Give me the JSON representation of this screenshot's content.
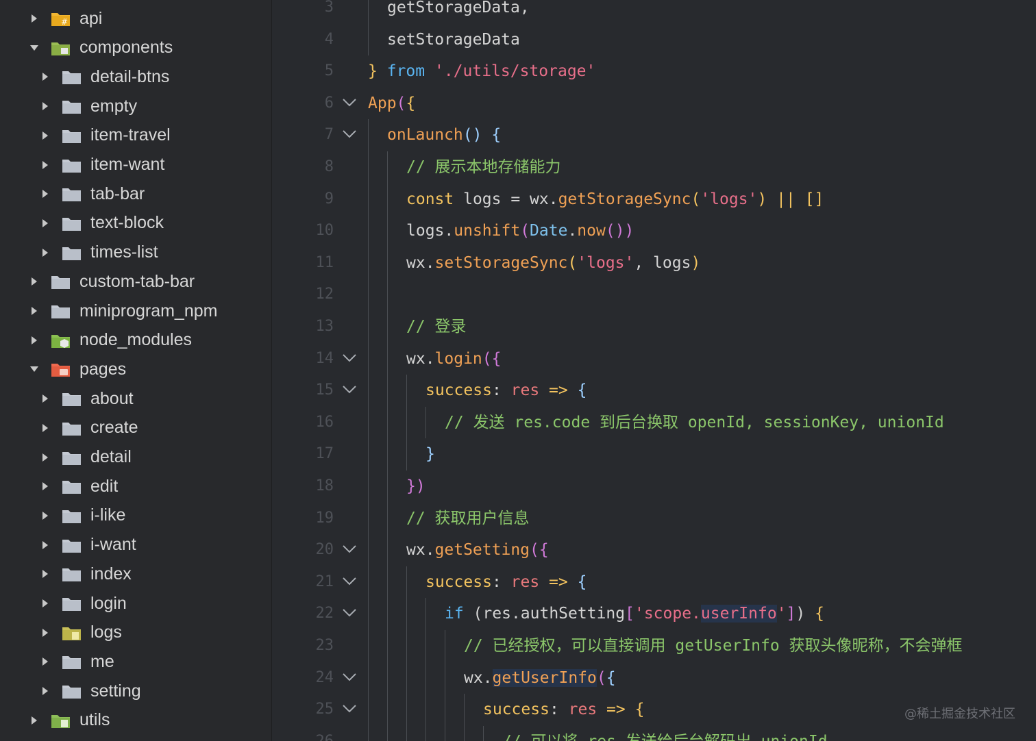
{
  "sidebar": {
    "items": [
      {
        "label": "api",
        "depth": 0,
        "expanded": false,
        "icon": "api-folder-icon"
      },
      {
        "label": "components",
        "depth": 0,
        "expanded": true,
        "icon": "components-folder-icon"
      },
      {
        "label": "detail-btns",
        "depth": 1,
        "expanded": false,
        "icon": "folder-icon"
      },
      {
        "label": "empty",
        "depth": 1,
        "expanded": false,
        "icon": "folder-icon"
      },
      {
        "label": "item-travel",
        "depth": 1,
        "expanded": false,
        "icon": "folder-icon"
      },
      {
        "label": "item-want",
        "depth": 1,
        "expanded": false,
        "icon": "folder-icon"
      },
      {
        "label": "tab-bar",
        "depth": 1,
        "expanded": false,
        "icon": "folder-icon"
      },
      {
        "label": "text-block",
        "depth": 1,
        "expanded": false,
        "icon": "folder-icon"
      },
      {
        "label": "times-list",
        "depth": 1,
        "expanded": false,
        "icon": "folder-icon"
      },
      {
        "label": "custom-tab-bar",
        "depth": 0,
        "expanded": false,
        "icon": "folder-icon"
      },
      {
        "label": "miniprogram_npm",
        "depth": 0,
        "expanded": false,
        "icon": "folder-icon"
      },
      {
        "label": "node_modules",
        "depth": 0,
        "expanded": false,
        "icon": "node-modules-folder-icon"
      },
      {
        "label": "pages",
        "depth": 0,
        "expanded": true,
        "icon": "pages-folder-icon"
      },
      {
        "label": "about",
        "depth": 1,
        "expanded": false,
        "icon": "folder-icon"
      },
      {
        "label": "create",
        "depth": 1,
        "expanded": false,
        "icon": "folder-icon"
      },
      {
        "label": "detail",
        "depth": 1,
        "expanded": false,
        "icon": "folder-icon"
      },
      {
        "label": "edit",
        "depth": 1,
        "expanded": false,
        "icon": "folder-icon"
      },
      {
        "label": "i-like",
        "depth": 1,
        "expanded": false,
        "icon": "folder-icon"
      },
      {
        "label": "i-want",
        "depth": 1,
        "expanded": false,
        "icon": "folder-icon"
      },
      {
        "label": "index",
        "depth": 1,
        "expanded": false,
        "icon": "folder-icon"
      },
      {
        "label": "login",
        "depth": 1,
        "expanded": false,
        "icon": "folder-icon"
      },
      {
        "label": "logs",
        "depth": 1,
        "expanded": false,
        "icon": "logs-folder-icon"
      },
      {
        "label": "me",
        "depth": 1,
        "expanded": false,
        "icon": "folder-icon"
      },
      {
        "label": "setting",
        "depth": 1,
        "expanded": false,
        "icon": "folder-icon"
      },
      {
        "label": "utils",
        "depth": 0,
        "expanded": false,
        "icon": "utils-folder-icon"
      }
    ]
  },
  "editor": {
    "lines": [
      {
        "num": "3",
        "indent": 1,
        "fold": false,
        "tokens": [
          [
            "getStorageData,",
            "base"
          ]
        ]
      },
      {
        "num": "4",
        "indent": 1,
        "fold": false,
        "tokens": [
          [
            "setStorageData",
            "base"
          ]
        ]
      },
      {
        "num": "5",
        "indent": 0,
        "fold": false,
        "tokens": [
          [
            "}",
            "kw"
          ],
          [
            " ",
            "base"
          ],
          [
            "from",
            "from"
          ],
          [
            " ",
            "base"
          ],
          [
            "'./utils/storage'",
            "str"
          ]
        ]
      },
      {
        "num": "6",
        "indent": 0,
        "fold": true,
        "tokens": [
          [
            "App",
            "fn"
          ],
          [
            "(",
            "br2"
          ],
          [
            "{",
            "kw"
          ]
        ]
      },
      {
        "num": "7",
        "indent": 1,
        "fold": true,
        "tokens": [
          [
            "onLaunch",
            "fn"
          ],
          [
            "() ",
            "br"
          ],
          [
            "{",
            "br"
          ]
        ]
      },
      {
        "num": "8",
        "indent": 2,
        "fold": false,
        "tokens": [
          [
            "// 展示本地存储能力",
            "cm"
          ]
        ]
      },
      {
        "num": "9",
        "indent": 2,
        "fold": false,
        "tokens": [
          [
            "const",
            "kw"
          ],
          [
            " logs = wx.",
            "base"
          ],
          [
            "getStorageSync",
            "fn"
          ],
          [
            "(",
            "kw"
          ],
          [
            "'logs'",
            "str"
          ],
          [
            ")",
            "kw"
          ],
          [
            " ",
            "base"
          ],
          [
            "||",
            "or"
          ],
          [
            " ",
            "base"
          ],
          [
            "[]",
            "kw"
          ]
        ]
      },
      {
        "num": "10",
        "indent": 2,
        "fold": false,
        "tokens": [
          [
            "logs.",
            "base"
          ],
          [
            "unshift",
            "fn"
          ],
          [
            "(",
            "br2"
          ],
          [
            "Date",
            "obj"
          ],
          [
            ".",
            "base"
          ],
          [
            "now",
            "fn"
          ],
          [
            "())",
            "br2"
          ]
        ]
      },
      {
        "num": "11",
        "indent": 2,
        "fold": false,
        "tokens": [
          [
            "wx.",
            "base"
          ],
          [
            "setStorageSync",
            "fn"
          ],
          [
            "(",
            "kw"
          ],
          [
            "'logs'",
            "str"
          ],
          [
            ", logs",
            "base"
          ],
          [
            ")",
            "kw"
          ]
        ]
      },
      {
        "num": "12",
        "indent": 2,
        "fold": false,
        "tokens": []
      },
      {
        "num": "13",
        "indent": 2,
        "fold": false,
        "tokens": [
          [
            "// 登录",
            "cm"
          ]
        ]
      },
      {
        "num": "14",
        "indent": 2,
        "fold": true,
        "tokens": [
          [
            "wx.",
            "base"
          ],
          [
            "login",
            "fn"
          ],
          [
            "(",
            "br2"
          ],
          [
            "{",
            "br2"
          ]
        ]
      },
      {
        "num": "15",
        "indent": 3,
        "fold": true,
        "tokens": [
          [
            "success",
            "prop"
          ],
          [
            ": ",
            "base"
          ],
          [
            "res",
            "param"
          ],
          [
            " => ",
            "kw"
          ],
          [
            "{",
            "br"
          ]
        ]
      },
      {
        "num": "16",
        "indent": 4,
        "fold": false,
        "tokens": [
          [
            "// 发送 res.code 到后台换取 openId, sessionKey, unionId",
            "cm"
          ]
        ]
      },
      {
        "num": "17",
        "indent": 3,
        "fold": false,
        "tokens": [
          [
            "}",
            "br"
          ]
        ]
      },
      {
        "num": "18",
        "indent": 2,
        "fold": false,
        "tokens": [
          [
            "})",
            "br2"
          ]
        ]
      },
      {
        "num": "19",
        "indent": 2,
        "fold": false,
        "tokens": [
          [
            "// 获取用户信息",
            "cm"
          ]
        ]
      },
      {
        "num": "20",
        "indent": 2,
        "fold": true,
        "tokens": [
          [
            "wx.",
            "base"
          ],
          [
            "getSetting",
            "fn"
          ],
          [
            "(",
            "br2"
          ],
          [
            "{",
            "br2"
          ]
        ]
      },
      {
        "num": "21",
        "indent": 3,
        "fold": true,
        "tokens": [
          [
            "success",
            "prop"
          ],
          [
            ": ",
            "base"
          ],
          [
            "res",
            "param"
          ],
          [
            " => ",
            "kw"
          ],
          [
            "{",
            "br"
          ]
        ]
      },
      {
        "num": "22",
        "indent": 4,
        "fold": true,
        "tokens": [
          [
            "if",
            "from"
          ],
          [
            " (res.authSetting",
            "base"
          ],
          [
            "[",
            "br2"
          ],
          [
            "'scope.",
            "str"
          ],
          [
            "userInfo",
            "str"
          ],
          [
            "'",
            "str"
          ],
          [
            "]",
            "br2"
          ],
          [
            ") ",
            "base"
          ],
          [
            "{",
            "kw"
          ]
        ]
      },
      {
        "num": "23",
        "indent": 5,
        "fold": false,
        "tokens": [
          [
            "// 已经授权，可以直接调用 getUserInfo 获取头像昵称，不会弹框",
            "cm"
          ]
        ]
      },
      {
        "num": "24",
        "indent": 5,
        "fold": true,
        "tokens": [
          [
            "wx.",
            "base"
          ],
          [
            "getUserInfo",
            "fn"
          ],
          [
            "(",
            "br2"
          ],
          [
            "{",
            "br"
          ]
        ]
      },
      {
        "num": "25",
        "indent": 6,
        "fold": true,
        "tokens": [
          [
            "success",
            "prop"
          ],
          [
            ": ",
            "base"
          ],
          [
            "res",
            "param"
          ],
          [
            " => ",
            "kw"
          ],
          [
            "{",
            "kw"
          ]
        ]
      },
      {
        "num": "26",
        "indent": 7,
        "fold": false,
        "tokens": [
          [
            "// 可以将 res 发送给后台解码出 unionId",
            "cm"
          ]
        ]
      }
    ]
  },
  "watermark": "@稀土掘金技术社区"
}
